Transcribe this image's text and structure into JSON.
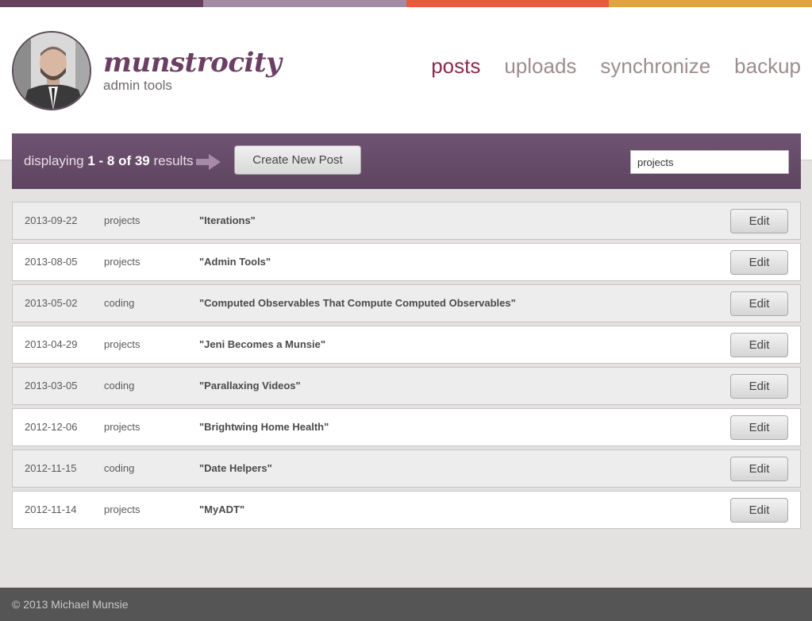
{
  "colors": {
    "strip": [
      "#65405f",
      "#a38ba5",
      "#e95a3c",
      "#e0a43e"
    ],
    "accent": "#8e2a4d",
    "toolbar": "#6a4e6b"
  },
  "header": {
    "logo": "munstrocity",
    "subtitle": "admin tools",
    "nav": [
      {
        "label": "posts",
        "active": true
      },
      {
        "label": "uploads",
        "active": false
      },
      {
        "label": "synchronize",
        "active": false
      },
      {
        "label": "backup",
        "active": false
      }
    ]
  },
  "toolbar": {
    "prefix": "displaying ",
    "range": "1 - 8 of 39",
    "suffix": " results",
    "create_label": "Create New Post",
    "search_value": "projects"
  },
  "posts": [
    {
      "date": "2013-09-22",
      "category": "projects",
      "title": "\"Iterations\"",
      "edit_label": "Edit"
    },
    {
      "date": "2013-08-05",
      "category": "projects",
      "title": "\"Admin Tools\"",
      "edit_label": "Edit"
    },
    {
      "date": "2013-05-02",
      "category": "coding",
      "title": "\"Computed Observables That Compute Computed Observables\"",
      "edit_label": "Edit"
    },
    {
      "date": "2013-04-29",
      "category": "projects",
      "title": "\"Jeni Becomes a Munsie\"",
      "edit_label": "Edit"
    },
    {
      "date": "2013-03-05",
      "category": "coding",
      "title": "\"Parallaxing Videos\"",
      "edit_label": "Edit"
    },
    {
      "date": "2012-12-06",
      "category": "projects",
      "title": "\"Brightwing Home Health\"",
      "edit_label": "Edit"
    },
    {
      "date": "2012-11-15",
      "category": "coding",
      "title": "\"Date Helpers\"",
      "edit_label": "Edit"
    },
    {
      "date": "2012-11-14",
      "category": "projects",
      "title": "\"MyADT\"",
      "edit_label": "Edit"
    }
  ],
  "footer": {
    "copyright": "© 2013 Michael Munsie"
  }
}
